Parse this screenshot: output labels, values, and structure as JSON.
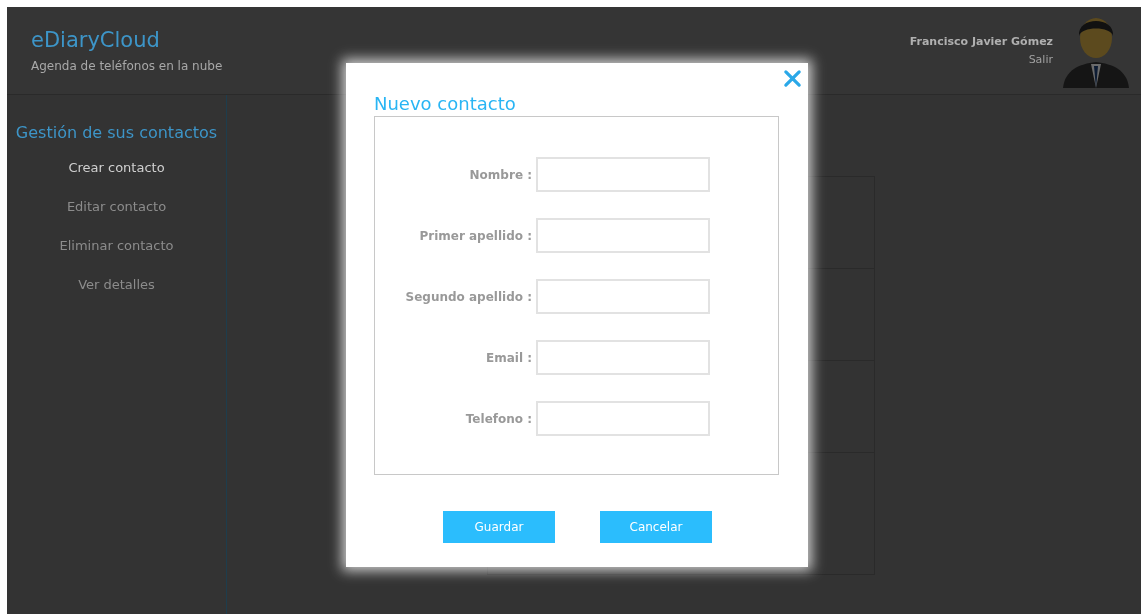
{
  "header": {
    "app_title": "eDiaryCloud",
    "subtitle": "Agenda de teléfonos en la nube",
    "user_name": "Francisco Javier Gómez",
    "logout": "Salir"
  },
  "sidebar": {
    "heading": "Gestión de sus contactos",
    "items": [
      {
        "label": "Crear contacto",
        "disabled": false
      },
      {
        "label": "Editar contacto",
        "disabled": true
      },
      {
        "label": "Eliminar contacto",
        "disabled": true
      },
      {
        "label": "Ver detalles",
        "disabled": true
      }
    ]
  },
  "dialog": {
    "title": "Nuevo contacto",
    "fields": [
      {
        "label": "Nombre :"
      },
      {
        "label": "Primer apellido :"
      },
      {
        "label": "Segundo apellido :"
      },
      {
        "label": "Email :"
      },
      {
        "label": "Telefono :"
      }
    ],
    "buttons": [
      "Guardar",
      "Cancelar"
    ]
  }
}
